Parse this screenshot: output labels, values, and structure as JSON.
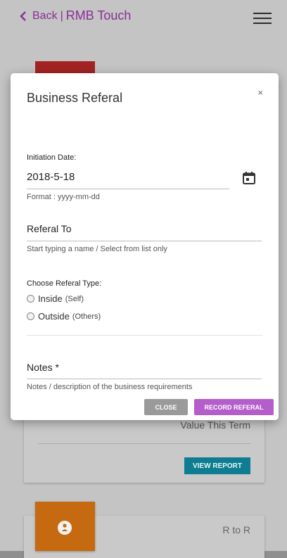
{
  "header": {
    "back_label": "Back",
    "separator": "|",
    "app_title": "RMB Touch"
  },
  "background": {
    "card": {
      "value_label": "Value This Term",
      "view_report_label": "VIEW REPORT"
    },
    "bottom_card": {
      "label": "R to R"
    }
  },
  "modal": {
    "title": "Business Referal",
    "close_glyph": "×",
    "initiation_date": {
      "label": "Initiation Date:",
      "value": "2018-5-18",
      "hint": "Format : yyyy-mm-dd"
    },
    "referal_to": {
      "label": "Referal To",
      "hint": "Start typing a name / Select from list only"
    },
    "referal_type": {
      "label": "Choose Referal Type:",
      "options": [
        {
          "label": "Inside",
          "sub": "(Self)",
          "selected": false
        },
        {
          "label": "Outside",
          "sub": "(Others)",
          "selected": false
        }
      ]
    },
    "notes": {
      "label": "Notes *",
      "hint": "Notes / description of the business requirements"
    },
    "buttons": {
      "close": "CLOSE",
      "record": "RECORD REFERAL"
    }
  },
  "colors": {
    "brand_purple": "#8a2d96",
    "record_button": "#b45fc9",
    "close_button": "#9a9a9a",
    "view_report": "#0e7d91",
    "red_tile": "#a32323",
    "orange_tile": "#c56a10"
  },
  "icons": [
    "chevron-left-icon",
    "hamburger-menu-icon",
    "calendar-icon",
    "person-icon",
    "close-icon"
  ]
}
